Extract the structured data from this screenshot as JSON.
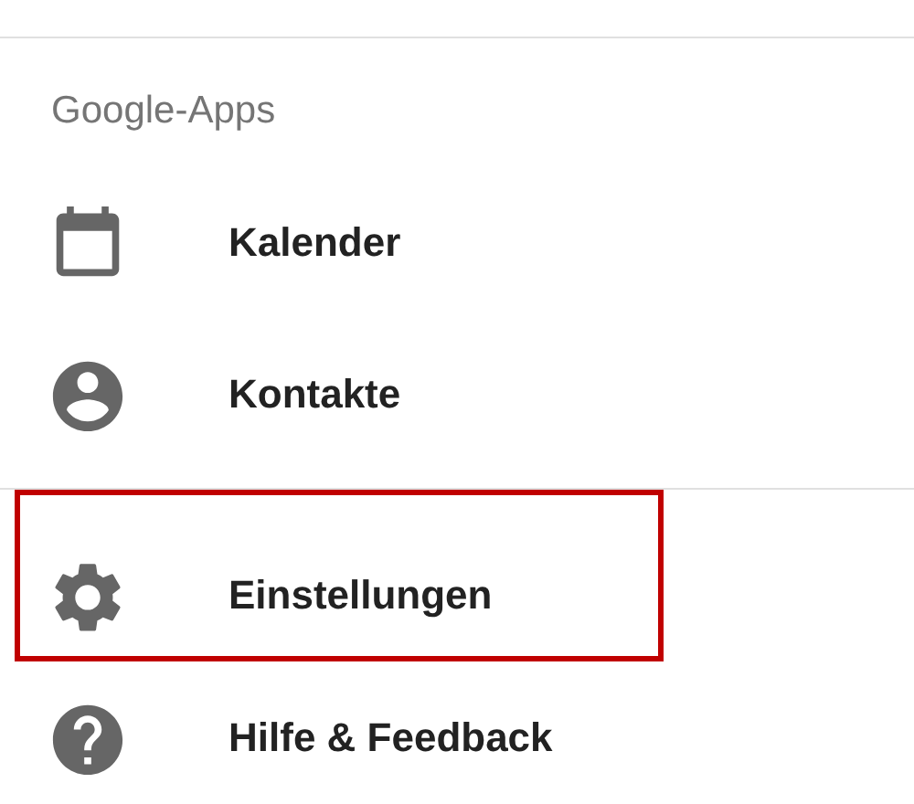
{
  "section_header": "Google-Apps",
  "groups": [
    {
      "items": [
        {
          "kind": "calendar",
          "label": "Kalender",
          "highlighted": false
        },
        {
          "kind": "contact",
          "label": "Kontakte",
          "highlighted": false
        }
      ]
    },
    {
      "items": [
        {
          "kind": "settings",
          "label": "Einstellungen",
          "highlighted": true
        },
        {
          "kind": "help",
          "label": "Hilfe & Feedback",
          "highlighted": false
        }
      ]
    }
  ]
}
